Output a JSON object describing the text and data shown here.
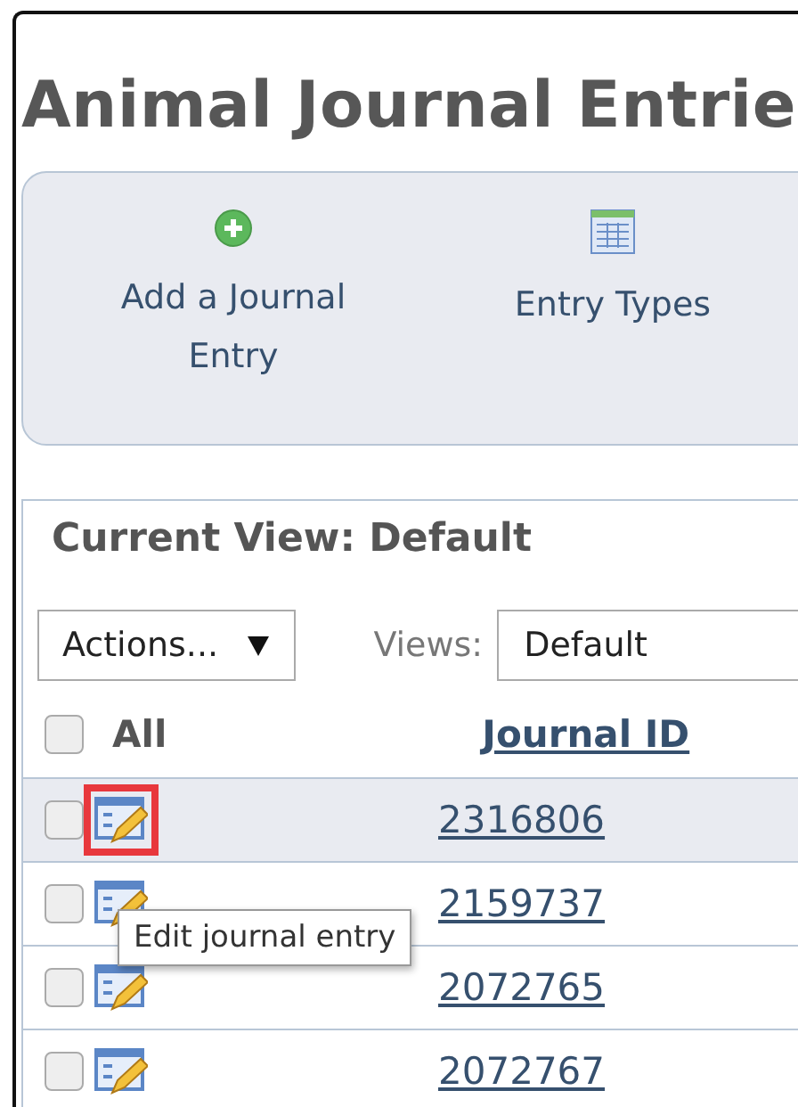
{
  "page_title": "Animal Journal Entrie",
  "toolbar": {
    "buttons": [
      {
        "kind": "add",
        "label": "Add a Journal Entry"
      },
      {
        "kind": "table",
        "label": "Entry Types"
      }
    ]
  },
  "grid": {
    "view_title": "Current View: Default",
    "actions_select": {
      "value": "Actions..."
    },
    "views_label": "Views:",
    "views_select": {
      "value": "Default"
    },
    "header": {
      "select_all": {
        "checked": false,
        "label": "All"
      },
      "columns": [
        "Journal ID"
      ]
    },
    "rows": [
      {
        "checked": false,
        "selected": true,
        "icon_highlighted": true,
        "journal_id": "2316806"
      },
      {
        "checked": false,
        "selected": false,
        "icon_highlighted": false,
        "journal_id": "2159737"
      },
      {
        "checked": false,
        "selected": false,
        "icon_highlighted": false,
        "journal_id": "2072765"
      },
      {
        "checked": false,
        "selected": false,
        "icon_highlighted": false,
        "journal_id": "2072767"
      }
    ]
  },
  "tooltip": {
    "text": "Edit journal entry"
  }
}
